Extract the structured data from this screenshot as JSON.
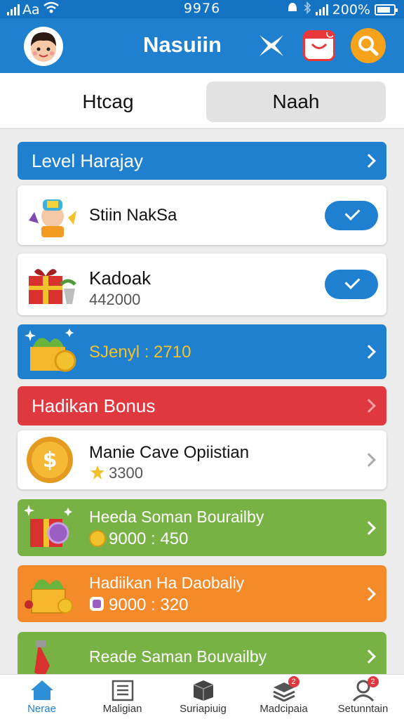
{
  "status_bar": {
    "carrier": "Aa",
    "time": "9976",
    "battery": "200%"
  },
  "header": {
    "title": "Nasuiin"
  },
  "tabs": [
    {
      "label": "Htcag"
    },
    {
      "label": "Naah"
    }
  ],
  "rows": [
    {
      "title": "Level Harajay"
    },
    {
      "title": "Stiin NakSa"
    },
    {
      "title": "Kadoak",
      "value": "442000"
    },
    {
      "title": "SJenyl : 2710"
    },
    {
      "title": "Hadikan Bonus"
    },
    {
      "title": "Manie Cave Opiistian",
      "value": "3300"
    },
    {
      "title": "Heeda Soman Bourailby",
      "value": "9000 : 450"
    },
    {
      "title": "Hadiikan Ha Daobaliy",
      "value": "9000 : 320"
    },
    {
      "title": "Reade Saman Bouvailby"
    }
  ],
  "bottom_nav": [
    {
      "label": "Nerae",
      "icon": "home-icon"
    },
    {
      "label": "Maligian",
      "icon": "list-icon"
    },
    {
      "label": "Suriapiuig",
      "icon": "box-icon",
      "badge": ""
    },
    {
      "label": "Madcipaia",
      "icon": "stack-icon",
      "badge": "2"
    },
    {
      "label": "Setunntain",
      "icon": "profile-icon",
      "badge": "2"
    }
  ],
  "colors": {
    "blue": "#1f80d0",
    "red": "#e0383f",
    "green": "#79b244",
    "orange": "#f48a2a"
  }
}
